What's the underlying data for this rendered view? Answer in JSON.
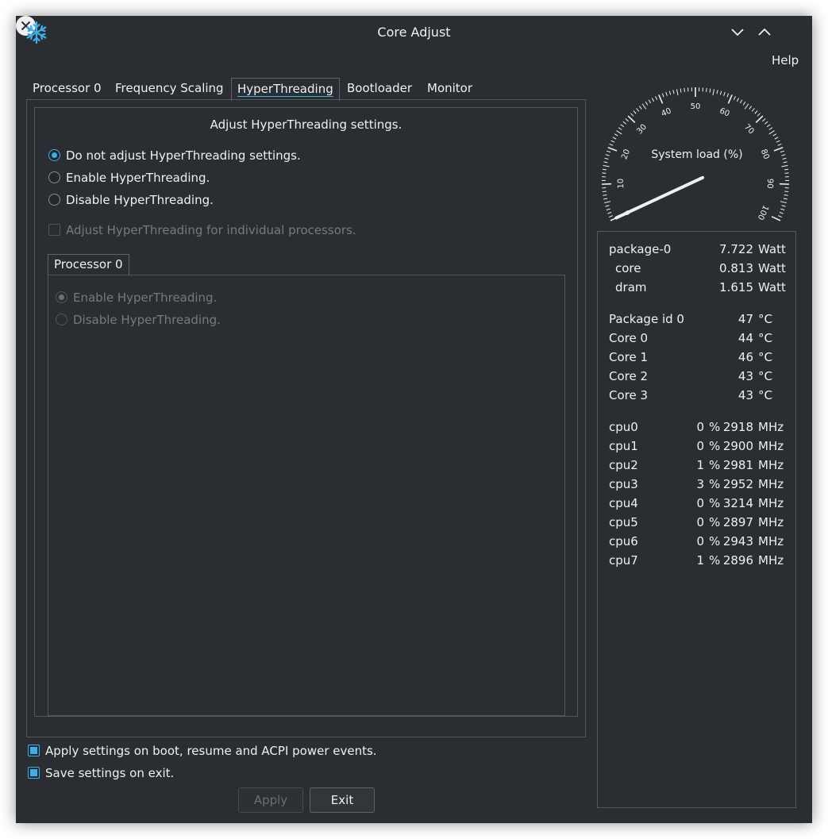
{
  "window": {
    "title": "Core Adjust",
    "menu_help": "Help"
  },
  "tabs": [
    {
      "label": "Processor 0"
    },
    {
      "label": "Frequency Scaling"
    },
    {
      "label": "HyperThreading"
    },
    {
      "label": "Bootloader"
    },
    {
      "label": "Monitor"
    }
  ],
  "active_tab": "HyperThreading",
  "hyperthreading": {
    "group_title": "Adjust HyperThreading settings.",
    "options": [
      {
        "label": "Do not adjust HyperThreading settings.",
        "checked": true
      },
      {
        "label": "Enable HyperThreading.",
        "checked": false
      },
      {
        "label": "Disable HyperThreading.",
        "checked": false
      }
    ],
    "individual_check": {
      "label": "Adjust HyperThreading for individual processors.",
      "checked": false,
      "enabled": false
    },
    "processor_tab": "Processor 0",
    "processor_options": [
      {
        "label": "Enable HyperThreading.",
        "checked": true
      },
      {
        "label": "Disable HyperThreading.",
        "checked": false
      }
    ]
  },
  "bottom": {
    "apply_on_boot": "Apply settings on boot, resume and ACPI power events.",
    "save_on_exit": "Save settings on exit.",
    "apply_button": "Apply",
    "exit_button": "Exit"
  },
  "gauge": {
    "label": "System load (%)",
    "value": 0,
    "ticks": [
      "0",
      "10",
      "20",
      "30",
      "40",
      "50",
      "60",
      "70",
      "80",
      "90",
      "100"
    ]
  },
  "power": [
    {
      "name": "package-0",
      "value": "7.722",
      "unit": "Watt"
    },
    {
      "name": "core",
      "value": "0.813",
      "unit": "Watt"
    },
    {
      "name": "dram",
      "value": "1.615",
      "unit": "Watt"
    }
  ],
  "temps": [
    {
      "name": "Package id 0",
      "value": "47",
      "unit": "°C"
    },
    {
      "name": "Core 0",
      "value": "44",
      "unit": "°C"
    },
    {
      "name": "Core 1",
      "value": "46",
      "unit": "°C"
    },
    {
      "name": "Core 2",
      "value": "43",
      "unit": "°C"
    },
    {
      "name": "Core 3",
      "value": "43",
      "unit": "°C"
    }
  ],
  "cpus": [
    {
      "name": "cpu0",
      "load": "0",
      "pct": "%",
      "mhz": "2918",
      "unit": "MHz"
    },
    {
      "name": "cpu1",
      "load": "0",
      "pct": "%",
      "mhz": "2900",
      "unit": "MHz"
    },
    {
      "name": "cpu2",
      "load": "1",
      "pct": "%",
      "mhz": "2981",
      "unit": "MHz"
    },
    {
      "name": "cpu3",
      "load": "3",
      "pct": "%",
      "mhz": "2952",
      "unit": "MHz"
    },
    {
      "name": "cpu4",
      "load": "0",
      "pct": "%",
      "mhz": "3214",
      "unit": "MHz"
    },
    {
      "name": "cpu5",
      "load": "0",
      "pct": "%",
      "mhz": "2897",
      "unit": "MHz"
    },
    {
      "name": "cpu6",
      "load": "0",
      "pct": "%",
      "mhz": "2943",
      "unit": "MHz"
    },
    {
      "name": "cpu7",
      "load": "1",
      "pct": "%",
      "mhz": "2896",
      "unit": "MHz"
    }
  ],
  "colors": {
    "accent": "#3daee9",
    "background": "#2a2e32",
    "text": "#eff0f1"
  },
  "icons": {
    "app": "snowflake-icon",
    "minimize": "chevron-down-icon",
    "maximize": "chevron-up-icon",
    "close": "close-icon"
  }
}
